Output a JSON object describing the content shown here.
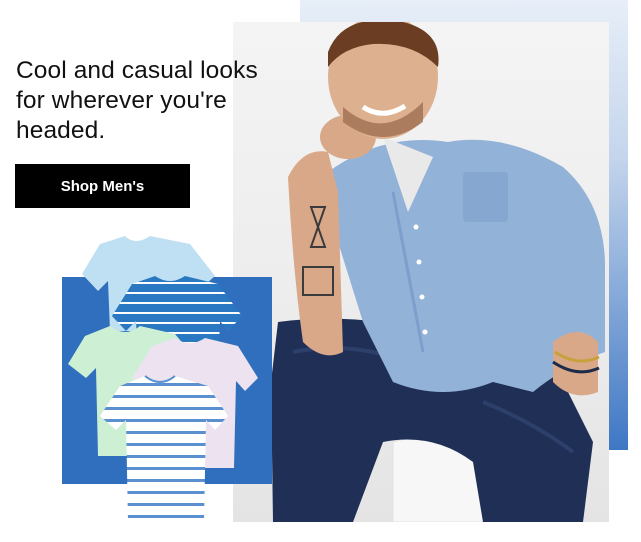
{
  "banner": {
    "headline": "Cool and casual looks for wherever you're headed.",
    "cta_label": "Shop Men's"
  },
  "colors": {
    "accent_blue": "#2f6fbe",
    "cta_background": "#000000",
    "cta_text": "#ffffff"
  },
  "images": {
    "product_photo": "stack-of-tshirts",
    "model_photo": "man-in-chambray-shirt"
  }
}
